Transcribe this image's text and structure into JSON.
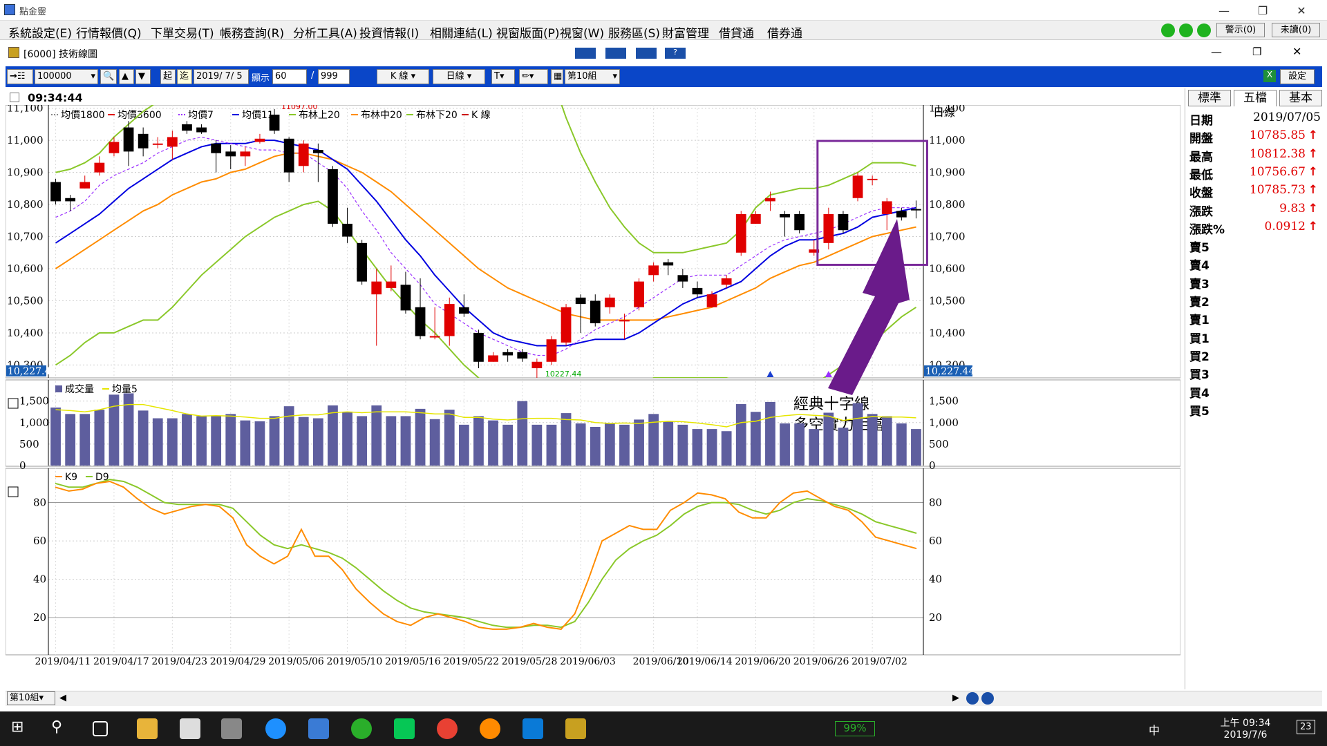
{
  "app": {
    "title": "點金靈"
  },
  "menu": [
    "系統設定(E)",
    "行情報價(Q)",
    "下單交易(T)",
    "帳務查詢(R)",
    "分析工具(A)",
    "投資情報(I)",
    "相關連結(L)",
    "視窗版面(P)",
    "視窗(W)",
    "服務區(S)",
    "財富管理",
    "借貸通",
    "借券通"
  ],
  "status_buttons": {
    "alert": "警示(0)",
    "unread": "未讀(0)"
  },
  "subwindow": {
    "title": "[6000] 技術線圖"
  },
  "toolbar": {
    "code": "100000",
    "start_label": "起",
    "end_label": "迄",
    "date": "2019/ 7/ 5",
    "show_label": "顯示",
    "show_count": "60",
    "max_count": "999",
    "kline_btn": "K 線",
    "period_btn": "日線",
    "text_btn": "T",
    "group_btn": "第10組",
    "settings_btn": "設定"
  },
  "time": "09:34:44",
  "legend_main": [
    "均價1800",
    "均價3600",
    "均價7",
    "均價11",
    "布林上20",
    "布林中20",
    "布林下20",
    "K 線"
  ],
  "legend_colors": [
    "#888888",
    "#e00000",
    "#9b30ff",
    "#0000e0",
    "#8ac82a",
    "#ff8c00",
    "#8ac82a",
    "#cc0000"
  ],
  "period_label": "日線",
  "price_axis": [
    "11,100",
    "11,000",
    "10,900",
    "10,800",
    "10,700",
    "10,600",
    "10,500",
    "10,400",
    "10,300"
  ],
  "volume_axis": [
    "1,500",
    "1,000",
    "500",
    "0"
  ],
  "kd_axis": [
    "80",
    "60",
    "40",
    "20"
  ],
  "low_box": "10,227.44",
  "annotations": {
    "high_mark": "11097.00",
    "low_mark": "10227.44",
    "note1": "經典十字線",
    "note2": "多空實力相當"
  },
  "legend_volume": [
    "成交量",
    "均量5"
  ],
  "legend_kd": [
    "K9",
    "D9"
  ],
  "dates": [
    "2019/04/11",
    "2019/04/17",
    "2019/04/23",
    "2019/04/29",
    "2019/05/06",
    "2019/05/10",
    "2019/05/16",
    "2019/05/22",
    "2019/05/28",
    "2019/06/03",
    "2019/06/10",
    "2019/06/14",
    "2019/06/20",
    "2019/06/26",
    "2019/07/02"
  ],
  "quote_tabs": [
    "標準",
    "五檔",
    "基本"
  ],
  "quote": [
    {
      "label": "日期",
      "value": "2019/07/05",
      "arrow": ""
    },
    {
      "label": "開盤",
      "value": "10785.85",
      "arrow": "↑"
    },
    {
      "label": "最高",
      "value": "10812.38",
      "arrow": "↑"
    },
    {
      "label": "最低",
      "value": "10756.67",
      "arrow": "↑"
    },
    {
      "label": "收盤",
      "value": "10785.73",
      "arrow": "↑"
    },
    {
      "label": "漲跌",
      "value": "9.83",
      "arrow": "↑"
    },
    {
      "label": "漲跌%",
      "value": "0.0912",
      "arrow": "↑"
    },
    {
      "label": "賣5",
      "value": "",
      "arrow": ""
    },
    {
      "label": "賣4",
      "value": "",
      "arrow": ""
    },
    {
      "label": "賣3",
      "value": "",
      "arrow": ""
    },
    {
      "label": "賣2",
      "value": "",
      "arrow": ""
    },
    {
      "label": "賣1",
      "value": "",
      "arrow": ""
    },
    {
      "label": "買1",
      "value": "",
      "arrow": ""
    },
    {
      "label": "買2",
      "value": "",
      "arrow": ""
    },
    {
      "label": "買3",
      "value": "",
      "arrow": ""
    },
    {
      "label": "買4",
      "value": "",
      "arrow": ""
    },
    {
      "label": "買5",
      "value": "",
      "arrow": ""
    }
  ],
  "statusbar": {
    "group": "第10組"
  },
  "taskbar": {
    "battery": "99%",
    "ime": "中",
    "time": "上午 09:34",
    "date": "2019/7/6",
    "notif": "23"
  },
  "chart_data": {
    "type": "candlestick",
    "x_labels": [
      "2019/04/11",
      "2019/04/17",
      "2019/04/23",
      "2019/04/29",
      "2019/05/06",
      "2019/05/10",
      "2019/05/16",
      "2019/05/22",
      "2019/05/28",
      "2019/06/03",
      "2019/06/10",
      "2019/06/14",
      "2019/06/20",
      "2019/06/26",
      "2019/07/02"
    ],
    "ylim": [
      10260,
      11110
    ],
    "candles": [
      [
        10870,
        10810,
        10880,
        10800
      ],
      [
        10820,
        10810,
        10830,
        10780
      ],
      [
        10850,
        10870,
        10890,
        10850
      ],
      [
        10900,
        10930,
        10950,
        10890
      ],
      [
        10960,
        10995,
        11010,
        10950
      ],
      [
        11040,
        10965,
        11060,
        10920
      ],
      [
        11020,
        10975,
        11040,
        10950
      ],
      [
        10990,
        10990,
        11010,
        10975
      ],
      [
        10980,
        11010,
        11030,
        10940
      ],
      [
        11050,
        11030,
        11060,
        11020
      ],
      [
        11040,
        11025,
        11050,
        11020
      ],
      [
        10990,
        10960,
        11000,
        10900
      ],
      [
        10965,
        10950,
        10985,
        10910
      ],
      [
        10950,
        10965,
        10980,
        10920
      ],
      [
        10995,
        11005,
        11020,
        10990
      ],
      [
        11080,
        11030,
        11097,
        11020
      ],
      [
        11005,
        10900,
        11010,
        10870
      ],
      [
        10920,
        10990,
        11000,
        10900
      ],
      [
        10970,
        10960,
        10990,
        10870
      ],
      [
        10910,
        10740,
        10920,
        10730
      ],
      [
        10740,
        10700,
        10790,
        10680
      ],
      [
        10680,
        10560,
        10690,
        10550
      ],
      [
        10520,
        10560,
        10600,
        10360
      ],
      [
        10540,
        10560,
        10610,
        10530
      ],
      [
        10550,
        10470,
        10590,
        10460
      ],
      [
        10480,
        10390,
        10570,
        10380
      ],
      [
        10390,
        10390,
        10480,
        10380
      ],
      [
        10390,
        10490,
        10510,
        10360
      ],
      [
        10480,
        10460,
        10520,
        10450
      ],
      [
        10400,
        10310,
        10410,
        10290
      ],
      [
        10310,
        10330,
        10340,
        10310
      ],
      [
        10340,
        10330,
        10350,
        10310
      ],
      [
        10340,
        10320,
        10350,
        10310
      ],
      [
        10290,
        10310,
        10320,
        10227.44
      ],
      [
        10310,
        10380,
        10390,
        10300
      ],
      [
        10370,
        10480,
        10490,
        10360
      ],
      [
        10510,
        10490,
        10520,
        10400
      ],
      [
        10500,
        10430,
        10520,
        10420
      ],
      [
        10480,
        10510,
        10520,
        10460
      ],
      [
        10440,
        10440,
        10460,
        10380
      ],
      [
        10480,
        10560,
        10570,
        10470
      ],
      [
        10580,
        10610,
        10620,
        10560
      ],
      [
        10620,
        10610,
        10630,
        10580
      ],
      [
        10580,
        10560,
        10600,
        10540
      ],
      [
        10540,
        10520,
        10560,
        10510
      ],
      [
        10480,
        10520,
        10530,
        10480
      ],
      [
        10550,
        10570,
        10580,
        10540
      ],
      [
        10650,
        10770,
        10780,
        10640
      ],
      [
        10740,
        10770,
        10780,
        10740
      ],
      [
        10810,
        10820,
        10840,
        10780
      ],
      [
        10770,
        10760,
        10780,
        10700
      ],
      [
        10770,
        10720,
        10780,
        10710
      ],
      [
        10650,
        10660,
        10690,
        10640
      ],
      [
        10680,
        10770,
        10790,
        10660
      ],
      [
        10770,
        10720,
        10780,
        10710
      ],
      [
        10820,
        10890,
        10900,
        10810
      ],
      [
        10880,
        10880,
        10890,
        10860
      ],
      [
        10770,
        10810,
        10820,
        10720
      ],
      [
        10780,
        10760,
        10790,
        10750
      ],
      [
        10785.85,
        10785.73,
        10812.38,
        10756.67
      ]
    ],
    "volume": [
      1350,
      1200,
      1200,
      1300,
      1650,
      1680,
      1280,
      1100,
      1100,
      1200,
      1150,
      1150,
      1200,
      1050,
      1030,
      1150,
      1380,
      1130,
      1100,
      1400,
      1250,
      1150,
      1400,
      1150,
      1150,
      1320,
      1080,
      1300,
      950,
      1150,
      1050,
      950,
      1500,
      950,
      950,
      1220,
      980,
      900,
      980,
      950,
      1070,
      1200,
      1020,
      950,
      850,
      850,
      800,
      1430,
      1250,
      1480,
      980,
      980,
      850,
      1230,
      880,
      1450,
      1200,
      1150,
      980,
      850
    ],
    "ma5_volume": [
      1300,
      1280,
      1250,
      1300,
      1380,
      1420,
      1420,
      1350,
      1280,
      1200,
      1150,
      1160,
      1150,
      1130,
      1100,
      1100,
      1150,
      1180,
      1180,
      1230,
      1250,
      1230,
      1250,
      1250,
      1250,
      1230,
      1200,
      1200,
      1120,
      1120,
      1080,
      1060,
      1090,
      1100,
      1100,
      1070,
      1060,
      1000,
      980,
      990,
      980,
      1010,
      1030,
      1020,
      990,
      950,
      900,
      1000,
      1030,
      1120,
      1160,
      1190,
      1170,
      1150,
      1050,
      1100,
      1140,
      1130,
      1130,
      1110
    ],
    "k9": [
      88,
      86,
      87,
      90,
      91,
      88,
      82,
      77,
      74,
      76,
      78,
      79,
      78,
      72,
      58,
      52,
      48,
      52,
      66,
      52,
      52,
      45,
      35,
      28,
      22,
      18,
      16,
      20,
      22,
      20,
      18,
      15,
      14,
      14,
      15,
      17,
      15,
      14,
      22,
      40,
      60,
      64,
      68,
      66,
      66,
      76,
      80,
      85,
      84,
      82,
      75,
      72,
      72,
      80,
      85,
      86,
      82,
      78,
      76,
      70,
      62,
      60,
      58,
      56
    ],
    "d9": [
      90,
      88,
      88,
      90,
      92,
      91,
      88,
      84,
      80,
      79,
      79,
      79,
      79,
      77,
      70,
      63,
      58,
      56,
      58,
      56,
      54,
      51,
      46,
      40,
      34,
      29,
      25,
      23,
      22,
      21,
      20,
      18,
      16,
      15,
      15,
      16,
      16,
      15,
      18,
      28,
      40,
      50,
      56,
      60,
      63,
      68,
      74,
      78,
      80,
      80,
      79,
      76,
      74,
      76,
      80,
      82,
      81,
      79,
      77,
      74,
      70,
      68,
      66,
      64
    ],
    "ma7": [
      10760,
      10780,
      10810,
      10860,
      10890,
      10910,
      10930,
      10960,
      10980,
      11000,
      11010,
      11000,
      10990,
      10980,
      10970,
      10970,
      10960,
      10960,
      10930,
      10900,
      10850,
      10780,
      10720,
      10650,
      10600,
      10550,
      10490,
      10460,
      10430,
      10400,
      10380,
      10360,
      10340,
      10330,
      10330,
      10350,
      10380,
      10410,
      10430,
      10450,
      10480,
      10510,
      10540,
      10570,
      10580,
      10580,
      10580,
      10610,
      10640,
      10670,
      10690,
      10700,
      10710,
      10720,
      10740,
      10760,
      10780,
      10790,
      10790,
      10790
    ],
    "ma11": [
      10680,
      10710,
      10740,
      10770,
      10810,
      10850,
      10880,
      10910,
      10940,
      10960,
      10980,
      10990,
      10990,
      10990,
      11000,
      11000,
      10990,
      10980,
      10970,
      10940,
      10910,
      10860,
      10810,
      10750,
      10690,
      10640,
      10580,
      10530,
      10480,
      10440,
      10400,
      10380,
      10370,
      10360,
      10360,
      10360,
      10370,
      10380,
      10380,
      10380,
      10400,
      10430,
      10460,
      10490,
      10510,
      10520,
      10540,
      10560,
      10600,
      10640,
      10670,
      10690,
      10690,
      10700,
      10710,
      10730,
      10760,
      10770,
      10780,
      10790
    ],
    "boll_upper": [
      10900,
      10910,
      10930,
      10960,
      11010,
      11050,
      11090,
      11120,
      11150,
      11170,
      11190,
      11200,
      11210,
      11220,
      11230,
      11240,
      11250,
      11260,
      11270,
      11280,
      11290,
      11300,
      11300,
      11300,
      11300,
      11300,
      11300,
      11300,
      11300,
      11300,
      11300,
      11300,
      11300,
      11300,
      11200,
      11070,
      10960,
      10870,
      10790,
      10730,
      10680,
      10650,
      10650,
      10650,
      10660,
      10670,
      10680,
      10720,
      10790,
      10830,
      10840,
      10850,
      10850,
      10860,
      10880,
      10900,
      10930,
      10930,
      10930,
      10920
    ],
    "boll_mid": [
      10600,
      10630,
      10660,
      10690,
      10720,
      10750,
      10780,
      10800,
      10830,
      10850,
      10870,
      10880,
      10900,
      10910,
      10930,
      10950,
      10960,
      10960,
      10950,
      10940,
      10920,
      10900,
      10870,
      10840,
      10800,
      10760,
      10720,
      10680,
      10640,
      10600,
      10570,
      10540,
      10520,
      10500,
      10480,
      10460,
      10450,
      10440,
      10440,
      10440,
      10440,
      10440,
      10450,
      10460,
      10470,
      10480,
      10500,
      10520,
      10540,
      10570,
      10590,
      10610,
      10620,
      10640,
      10660,
      10680,
      10700,
      10710,
      10720,
      10730
    ],
    "boll_lower": [
      10300,
      10330,
      10370,
      10400,
      10400,
      10420,
      10440,
      10440,
      10480,
      10530,
      10580,
      10620,
      10660,
      10700,
      10730,
      10760,
      10780,
      10800,
      10810,
      10780,
      10720,
      10660,
      10600,
      10540,
      10490,
      10440,
      10400,
      10350,
      10300,
      10260,
      10230,
      10220,
      10220,
      10220,
      10220,
      10220,
      10220,
      10220,
      10220,
      10220,
      10240,
      10260,
      10260,
      10260,
      10260,
      10260,
      10260,
      10250,
      10220,
      10220,
      10220,
      10220,
      10240,
      10270,
      10300,
      10330,
      10370,
      10410,
      10450,
      10480
    ]
  }
}
